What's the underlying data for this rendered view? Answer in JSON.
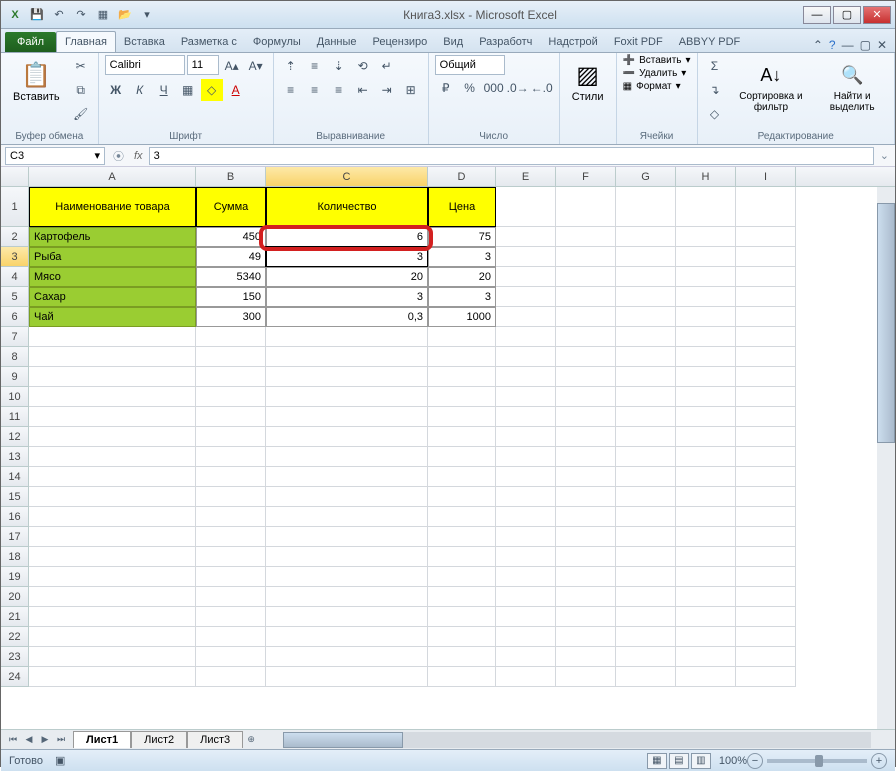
{
  "title": "Книга3.xlsx - Microsoft Excel",
  "qat": {
    "excel_icon": "X",
    "save": "💾",
    "undo": "↶",
    "redo": "↷",
    "new": "▦",
    "open": "📂"
  },
  "tabs": {
    "file": "Файл",
    "items": [
      "Главная",
      "Вставка",
      "Разметка с",
      "Формулы",
      "Данные",
      "Рецензиро",
      "Вид",
      "Разработч",
      "Надстрой",
      "Foxit PDF",
      "ABBYY PDF"
    ],
    "active_index": 0
  },
  "ribbon": {
    "clipboard": {
      "paste": "Вставить",
      "label": "Буфер обмена"
    },
    "font": {
      "name": "Calibri",
      "size": "11",
      "label": "Шрифт"
    },
    "alignment": {
      "label": "Выравнивание"
    },
    "number": {
      "format": "Общий",
      "label": "Число"
    },
    "styles": {
      "btn": "Стили"
    },
    "cells": {
      "insert": "Вставить",
      "delete": "Удалить",
      "format": "Формат",
      "label": "Ячейки"
    },
    "editing": {
      "sort": "Сортировка и фильтр",
      "find": "Найти и выделить",
      "label": "Редактирование"
    }
  },
  "name_box": "C3",
  "formula": "3",
  "columns": [
    "A",
    "B",
    "C",
    "D",
    "E",
    "F",
    "G",
    "H",
    "I"
  ],
  "selected_col_index": 2,
  "selected_row_index": 2,
  "table": {
    "headers": [
      "Наименование товара",
      "Сумма",
      "Количество",
      "Цена"
    ],
    "rows": [
      {
        "name": "Картофель",
        "sum": "450",
        "qty": "6",
        "price": "75"
      },
      {
        "name": "Рыба",
        "sum": "49",
        "qty": "3",
        "price": "3"
      },
      {
        "name": "Мясо",
        "sum": "5340",
        "qty": "20",
        "price": "20"
      },
      {
        "name": "Сахар",
        "sum": "150",
        "qty": "3",
        "price": "3"
      },
      {
        "name": "Чай",
        "sum": "300",
        "qty": "0,3",
        "price": "1000"
      }
    ],
    "highlighted_cell": {
      "row": 1,
      "col": "qty"
    }
  },
  "sheets": {
    "items": [
      "Лист1",
      "Лист2",
      "Лист3"
    ],
    "active": 0
  },
  "status": {
    "ready": "Готово",
    "zoom": "100%"
  }
}
